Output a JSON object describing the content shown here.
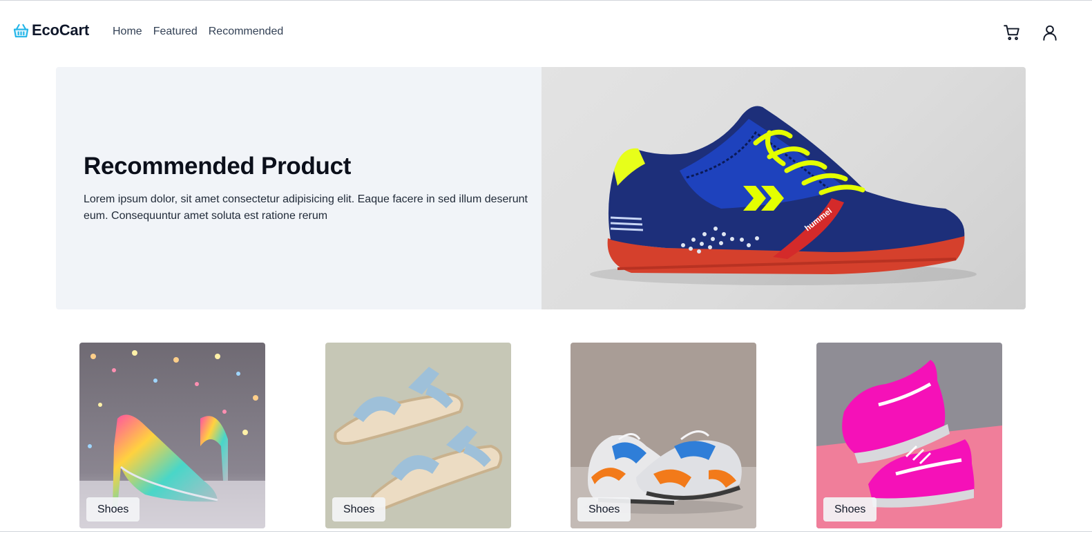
{
  "brand": {
    "name": "EcoCart",
    "icon": "basket-icon",
    "accent": "#22b5e8"
  },
  "nav": [
    {
      "label": "Home"
    },
    {
      "label": "Featured"
    },
    {
      "label": "Recommended"
    }
  ],
  "header_actions": {
    "cart_icon": "cart-icon",
    "user_icon": "user-icon"
  },
  "hero": {
    "title": "Recommended Product",
    "description": "Lorem ipsum dolor, sit amet consectetur adipisicing elit. Eaque facere in sed illum deserunt eum. Consequuntur amet soluta est ratione rerum",
    "image": "blue-sneaker-image",
    "brand_on_shoe": "hummel"
  },
  "products": [
    {
      "category": "Shoes",
      "image": "glitter-heels-image"
    },
    {
      "category": "Shoes",
      "image": "denim-sandals-image"
    },
    {
      "category": "Shoes",
      "image": "orange-blue-sneakers-image"
    },
    {
      "category": "Shoes",
      "image": "pink-sneakers-image"
    }
  ],
  "colors": {
    "hero_bg": "#f1f4f8",
    "text": "#0b0f1a",
    "nav_text": "#334155"
  }
}
